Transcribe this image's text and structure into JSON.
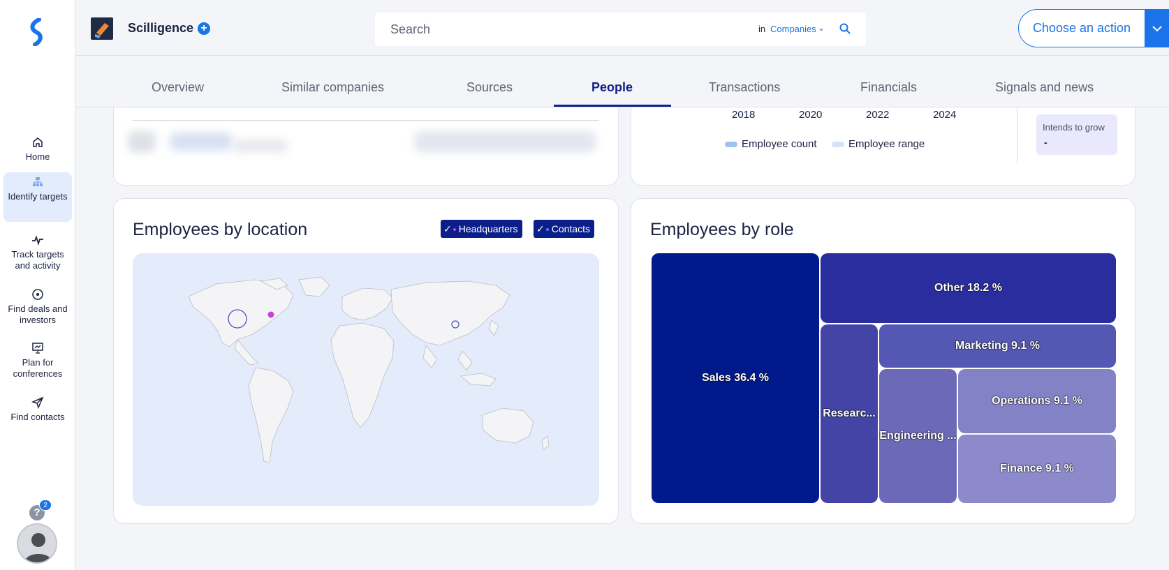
{
  "sidebar": {
    "items": [
      {
        "label": "Home",
        "icon": "home-icon"
      },
      {
        "label": "Identify targets",
        "icon": "sitemap-icon"
      },
      {
        "label": "Track targets and activity",
        "icon": "activity-icon"
      },
      {
        "label": "Find deals and investors",
        "icon": "target-icon"
      },
      {
        "label": "Plan for conferences",
        "icon": "presentation-icon"
      },
      {
        "label": "Find contacts",
        "icon": "send-icon"
      }
    ],
    "help_badge": "2"
  },
  "header": {
    "company_name": "Scilligence",
    "search_placeholder": "Search",
    "search_in": "in",
    "search_scope": "Companies",
    "action_label": "Choose an action"
  },
  "tabs": [
    "Overview",
    "Similar companies",
    "Sources",
    "People",
    "Transactions",
    "Financials",
    "Signals and news"
  ],
  "active_tab": "People",
  "headcount": {
    "years": [
      "2018",
      "2020",
      "2022",
      "2024"
    ],
    "legend": [
      "Employee count",
      "Employee range"
    ],
    "grow_label": "Intends to grow",
    "grow_value": "-"
  },
  "location": {
    "title": "Employees by location",
    "filters": [
      "Headquarters",
      "Contacts"
    ],
    "colors": {
      "headquarters": "#c442d8",
      "contacts": "#4b52b8"
    }
  },
  "role": {
    "title": "Employees by role",
    "tiles": [
      {
        "label": "Sales 36.4 %",
        "color": "#001a8c"
      },
      {
        "label": "Other 18.2 %",
        "color": "#2a2d9e"
      },
      {
        "label": "Researc...",
        "color": "#4444a6"
      },
      {
        "label": "Marketing 9.1 %",
        "color": "#5558b2"
      },
      {
        "label": "Engineering ...",
        "color": "#6b69b8"
      },
      {
        "label": "Operations 9.1 %",
        "color": "#8482c6"
      },
      {
        "label": "Finance 9.1 %",
        "color": "#8c8acb"
      }
    ]
  },
  "colors": {
    "accent": "#1a73e8",
    "navy": "#0f1f8a"
  }
}
